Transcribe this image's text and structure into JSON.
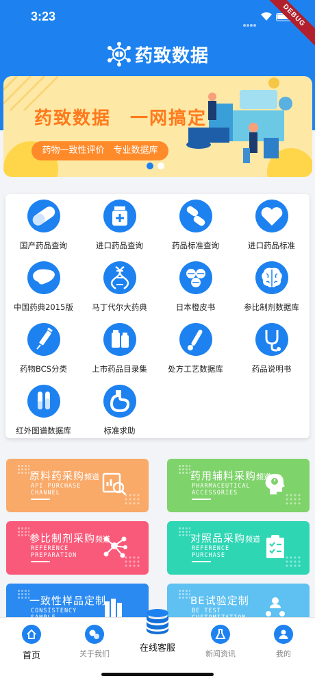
{
  "status_bar": {
    "time": "3:23",
    "debug_label": "DEBUG"
  },
  "header": {
    "app_name": "药致数据",
    "logo_icon": "molecule-logo-icon"
  },
  "banner": {
    "headline": "药致数据　一网搞定",
    "subline": "药物一致性评价　专业数据库",
    "page_count": 2,
    "active_page": 1
  },
  "grid": [
    {
      "label": "国产药品查询",
      "icon": "pill-capsule-icon"
    },
    {
      "label": "进口药品查询",
      "icon": "medicine-bottle-icon"
    },
    {
      "label": "药品标准查询",
      "icon": "capsules-icon"
    },
    {
      "label": "进口药品标准",
      "icon": "heart-icon"
    },
    {
      "label": "中国药典2015版",
      "icon": "liver-icon"
    },
    {
      "label": "马丁代尔大药典",
      "icon": "dna-icon"
    },
    {
      "label": "日本橙皮书",
      "icon": "tablets-icon"
    },
    {
      "label": "参比制剂数据库",
      "icon": "brain-icon"
    },
    {
      "label": "药物BCS分类",
      "icon": "syringe-icon"
    },
    {
      "label": "上市药品目录集",
      "icon": "medicine-bottles-icon"
    },
    {
      "label": "处方工艺数据库",
      "icon": "thermometer-icon"
    },
    {
      "label": "药品说明书",
      "icon": "stethoscope-icon"
    },
    {
      "label": "红外图谱数据库",
      "icon": "test-tubes-icon"
    },
    {
      "label": "标准求助",
      "icon": "stomach-icon"
    }
  ],
  "tiles": [
    {
      "title": "原料药采购",
      "suffix": "频道",
      "en": [
        "API PURCHASE",
        "CHANNEL"
      ],
      "color": "#f9a968",
      "icon": "magnifier-chart-icon"
    },
    {
      "title": "药用辅料采购",
      "suffix": "频道",
      "en": [
        "PHARMACEUTICAL",
        "ACCESSORIES"
      ],
      "color": "#7fd36b",
      "icon": "head-idea-icon"
    },
    {
      "title": "参比制剂采购",
      "suffix": "频道",
      "en": [
        "REFERENCE",
        "PREPARATION"
      ],
      "color": "#fa5a7a",
      "icon": "network-nodes-icon"
    },
    {
      "title": "对照品采购",
      "suffix": "频道",
      "en": [
        "REFERENCE",
        "PURCHASE"
      ],
      "color": "#2ed6b4",
      "icon": "clipboard-check-icon"
    },
    {
      "title": "一致性样品定制",
      "suffix": "",
      "en": [
        "CONSISTENCY",
        "SAMPLE"
      ],
      "color": "#2a8af1",
      "icon": "books-icon"
    },
    {
      "title": "BE试验定制",
      "suffix": "",
      "en": [
        "BE TEST",
        "CUSTOMIZATION"
      ],
      "color": "#5ec1f2",
      "icon": "org-chart-icon"
    }
  ],
  "bottom_nav": [
    {
      "label": "首页",
      "icon": "home-icon"
    },
    {
      "label": "关于我们",
      "icon": "pills-icon"
    },
    {
      "label": "在线客服",
      "icon": "database-icon"
    },
    {
      "label": "新闻资讯",
      "icon": "flask-icon"
    },
    {
      "label": "我的",
      "icon": "user-icon"
    }
  ]
}
